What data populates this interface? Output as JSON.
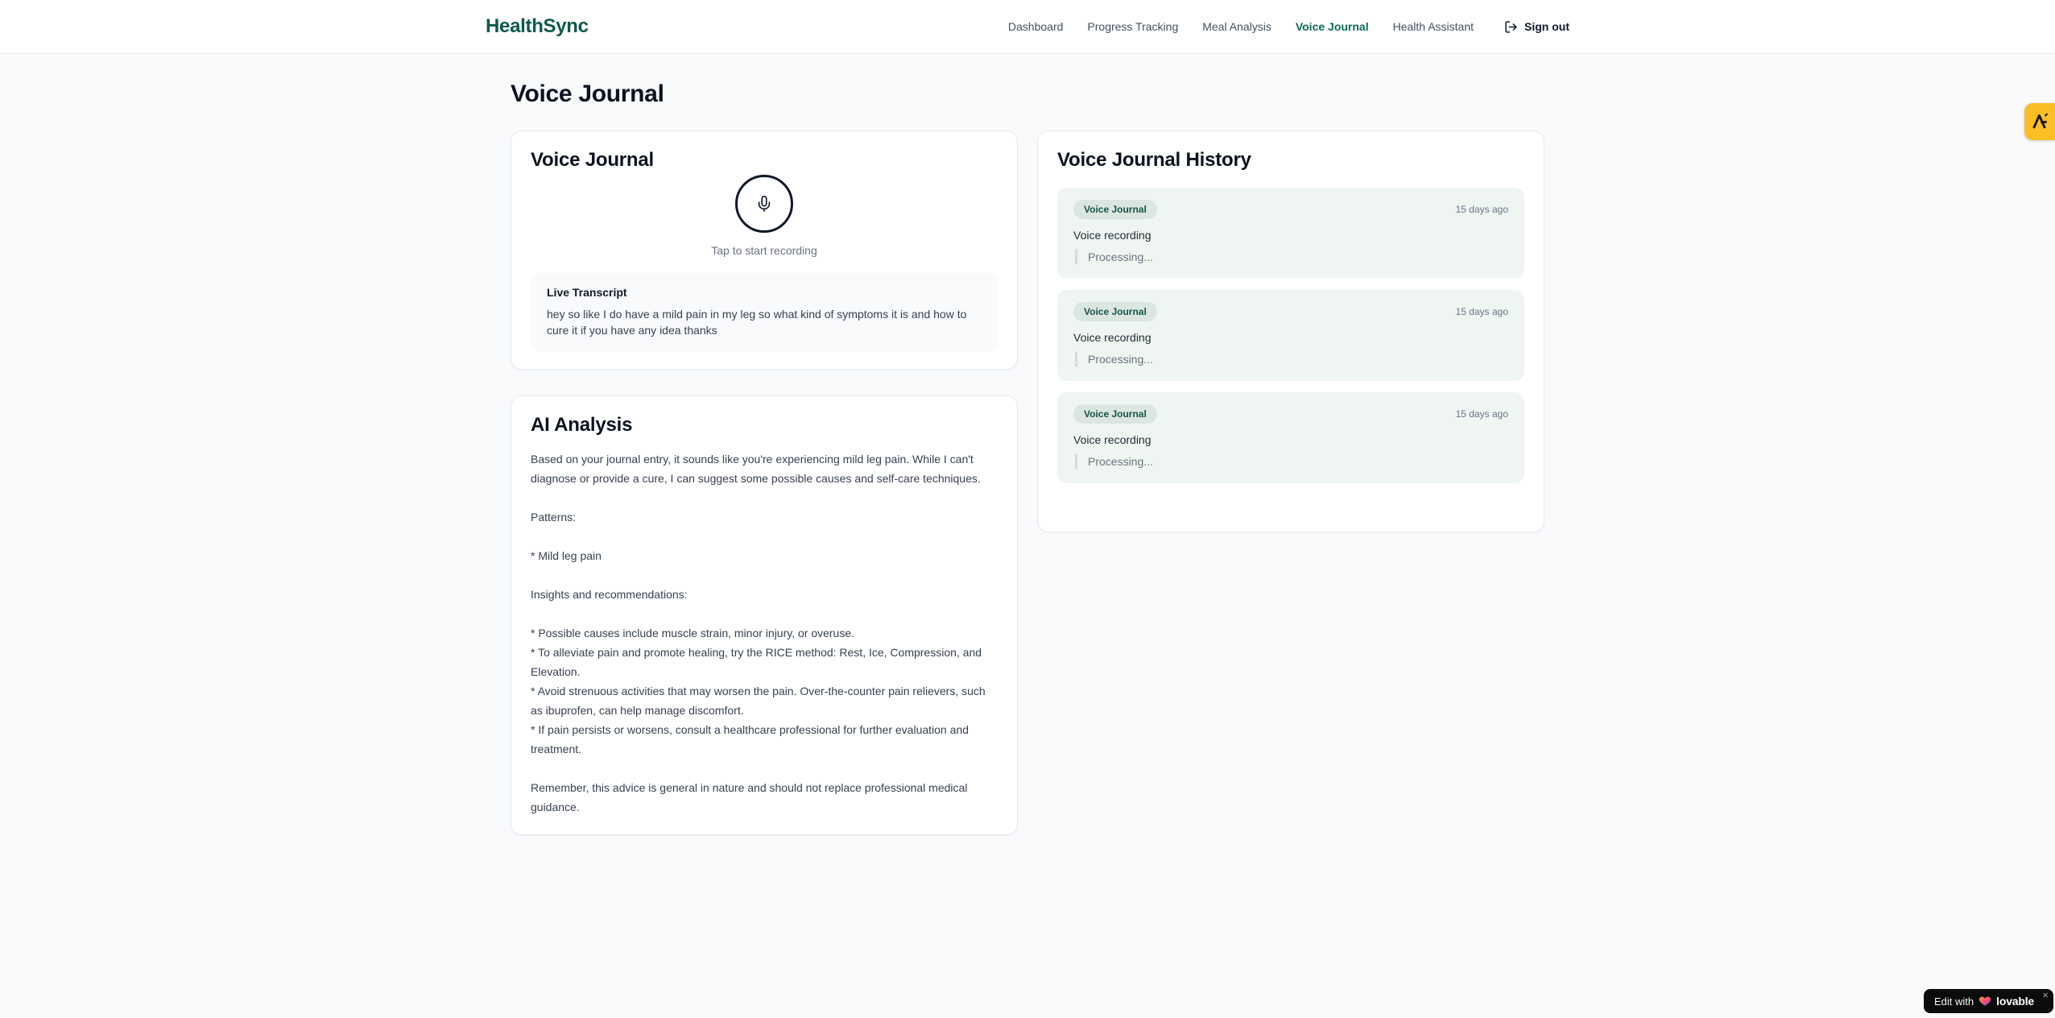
{
  "brand": {
    "name": "HealthSync"
  },
  "nav": {
    "items": [
      {
        "label": "Dashboard",
        "active": false
      },
      {
        "label": "Progress Tracking",
        "active": false
      },
      {
        "label": "Meal Analysis",
        "active": false
      },
      {
        "label": "Voice Journal",
        "active": true
      },
      {
        "label": "Health Assistant",
        "active": false
      }
    ],
    "sign_out_label": "Sign out"
  },
  "page": {
    "title": "Voice Journal"
  },
  "recorder_card": {
    "title": "Voice Journal",
    "tap_hint": "Tap to start recording",
    "transcript_label": "Live Transcript",
    "transcript_text": "hey so like I do have a mild pain in my leg so what kind of symptoms it is and how to cure it if you have any idea thanks"
  },
  "analysis_card": {
    "title": "AI Analysis",
    "body": "Based on your journal entry, it sounds like you're experiencing mild leg pain. While I can't diagnose or provide a cure, I can suggest some possible causes and self-care techniques.\n\nPatterns:\n\n* Mild leg pain\n\nInsights and recommendations:\n\n* Possible causes include muscle strain, minor injury, or overuse.\n* To alleviate pain and promote healing, try the RICE method: Rest, Ice, Compression, and Elevation.\n* Avoid strenuous activities that may worsen the pain. Over-the-counter pain relievers, such as ibuprofen, can help manage discomfort.\n* If pain persists or worsens, consult a healthcare professional for further evaluation and treatment.\n\nRemember, this advice is general in nature and should not replace professional medical guidance."
  },
  "history_card": {
    "title": "Voice Journal History",
    "entries": [
      {
        "badge": "Voice Journal",
        "time": "15 days ago",
        "title": "Voice recording",
        "status": "Processing..."
      },
      {
        "badge": "Voice Journal",
        "time": "15 days ago",
        "title": "Voice recording",
        "status": "Processing..."
      },
      {
        "badge": "Voice Journal",
        "time": "15 days ago",
        "title": "Voice recording",
        "status": "Processing..."
      }
    ]
  },
  "lovable": {
    "edit_with": "Edit with",
    "brand": "lovable",
    "close": "×"
  },
  "colors": {
    "brand_green": "#0c5a4c",
    "active_nav_green": "#0d6a58",
    "history_badge_bg": "#dce6e1",
    "history_badge_text": "#15544a",
    "history_entry_bg": "#eff6f1",
    "extension_badge_amber": "#fbbf24",
    "lovable_badge_bg": "#0c0c0d",
    "heart_gradient": [
      "#ff9c40",
      "#ff4a78",
      "#2e6bff"
    ]
  }
}
